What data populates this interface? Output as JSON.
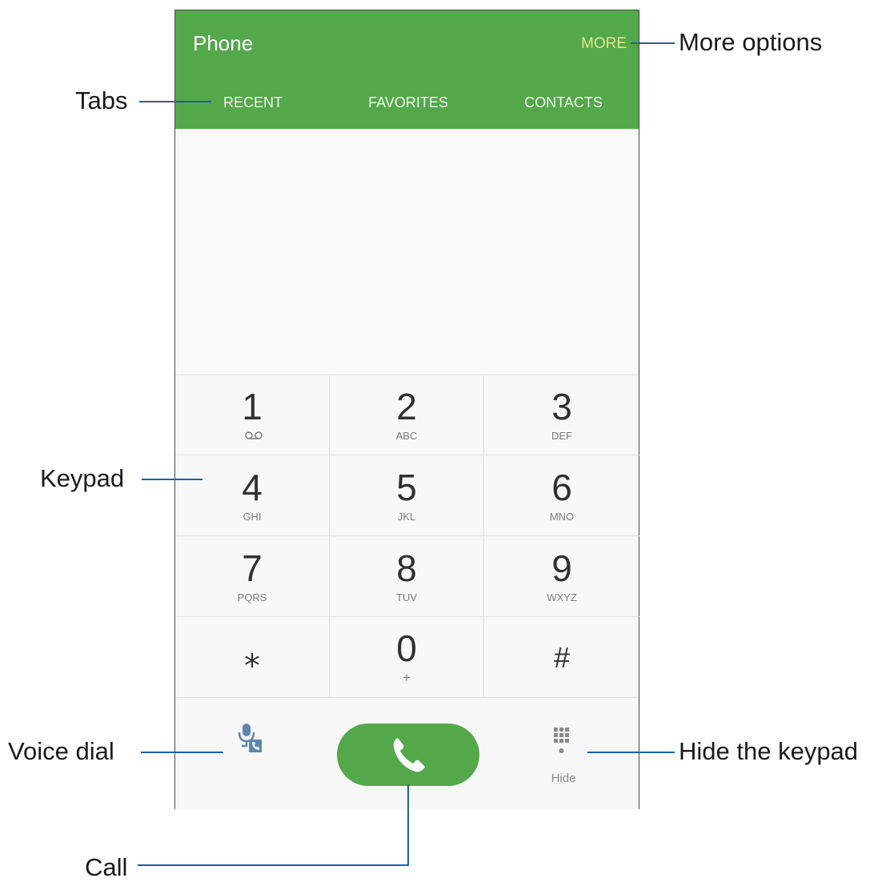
{
  "app": {
    "title": "Phone",
    "more_label": "MORE"
  },
  "tabs": [
    {
      "label": "RECENT"
    },
    {
      "label": "FAVORITES"
    },
    {
      "label": "CONTACTS"
    }
  ],
  "keypad": {
    "keys": [
      {
        "digit": "1",
        "sub": ""
      },
      {
        "digit": "2",
        "sub": "ABC"
      },
      {
        "digit": "3",
        "sub": "DEF"
      },
      {
        "digit": "4",
        "sub": "GHI"
      },
      {
        "digit": "5",
        "sub": "JKL"
      },
      {
        "digit": "6",
        "sub": "MNO"
      },
      {
        "digit": "7",
        "sub": "PQRS"
      },
      {
        "digit": "8",
        "sub": "TUV"
      },
      {
        "digit": "9",
        "sub": "WXYZ"
      },
      {
        "digit": "⁎",
        "sub": ""
      },
      {
        "digit": "0",
        "sub": "+"
      },
      {
        "digit": "#",
        "sub": ""
      }
    ]
  },
  "bottom": {
    "hide_label": "Hide"
  },
  "callouts": {
    "more_options": "More options",
    "tabs": "Tabs",
    "keypad": "Keypad",
    "voice_dial": "Voice dial",
    "hide_keypad": "Hide the keypad",
    "call": "Call"
  },
  "colors": {
    "appbar": "#53a84a",
    "more_text": "#e1e98a",
    "callout_line": "#1f5fa8",
    "voice_icon": "#5b86ad"
  },
  "icons": {
    "voicemail": "voicemail-icon",
    "voice_dial": "microphone-phone-icon",
    "call": "phone-handset-icon",
    "hide": "dialpad-icon"
  }
}
